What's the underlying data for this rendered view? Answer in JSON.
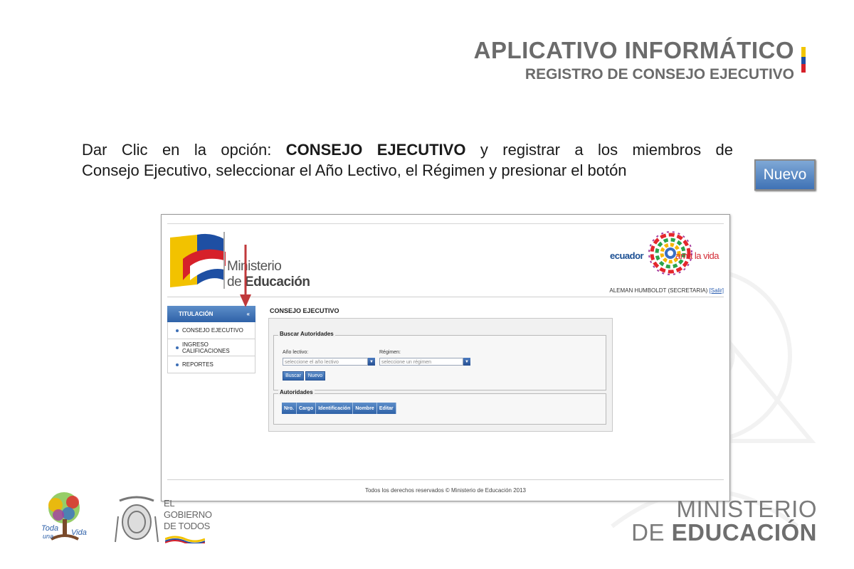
{
  "slide": {
    "title": "APLICATIVO INFORMÁTICO",
    "subtitle": "REGISTRO DE CONSEJO EJECUTIVO",
    "flag_colors": [
      "#f2c500",
      "#1f4ea3",
      "#d6202a"
    ]
  },
  "instruction": {
    "part1": "Dar Clic en la opción: ",
    "highlight": "CONSEJO EJECUTIVO",
    "part2": " y registrar a los miembros de",
    "line2": "Consejo Ejecutivo,  seleccionar el Año Lectivo, el Régimen y presionar el botón",
    "button_label": "Nuevo"
  },
  "app": {
    "logo_line1": "Ministerio",
    "logo_line2_prefix": "de ",
    "logo_line2_bold": "Educación",
    "ecuador_word": "ecuador",
    "amalavida_word": "ama la vida",
    "user_text": "ALEMAN HUMBOLDT (SECRETARIA) ",
    "logout_label": "[Salir]",
    "menu": {
      "header": "TITULACIÓN",
      "collapse_icon": "«",
      "items": [
        {
          "label": "CONSEJO EJECUTIVO"
        },
        {
          "label": "INGRESO CALIFICACIONES"
        },
        {
          "label": "REPORTES"
        }
      ]
    },
    "content_title": "CONSEJO EJECUTIVO",
    "search": {
      "legend": "Buscar Autoridades",
      "year_label": "Año lectivo:",
      "year_placeholder": "seleccione el año lectivo",
      "regime_label": "Régimen:",
      "regime_placeholder": "seleccione un régimen",
      "search_button": "Buscar",
      "new_button": "Nuevo"
    },
    "authorities": {
      "legend": "Autoridades",
      "columns": [
        "Nro.",
        "Cargo",
        "Identificación",
        "Nombre",
        "Editar"
      ]
    },
    "footer": "Todos los derechos reservados © Ministerio de Educación 2013"
  },
  "bottom": {
    "toda_line1": "Toda",
    "toda_line2": "una",
    "toda_line3": "Vida",
    "gobierno_line1": "EL",
    "gobierno_line2": "GOBIERNO",
    "gobierno_line3": "DE TODOS",
    "ministerio_line1": "MINISTERIO",
    "ministerio_line2_prefix": "DE ",
    "ministerio_line2_bold": "EDUCACIÓN"
  },
  "colors": {
    "accent_blue": "#2f62a8",
    "arrow_red": "#c0393b",
    "title_gray": "#6b6b6b"
  }
}
